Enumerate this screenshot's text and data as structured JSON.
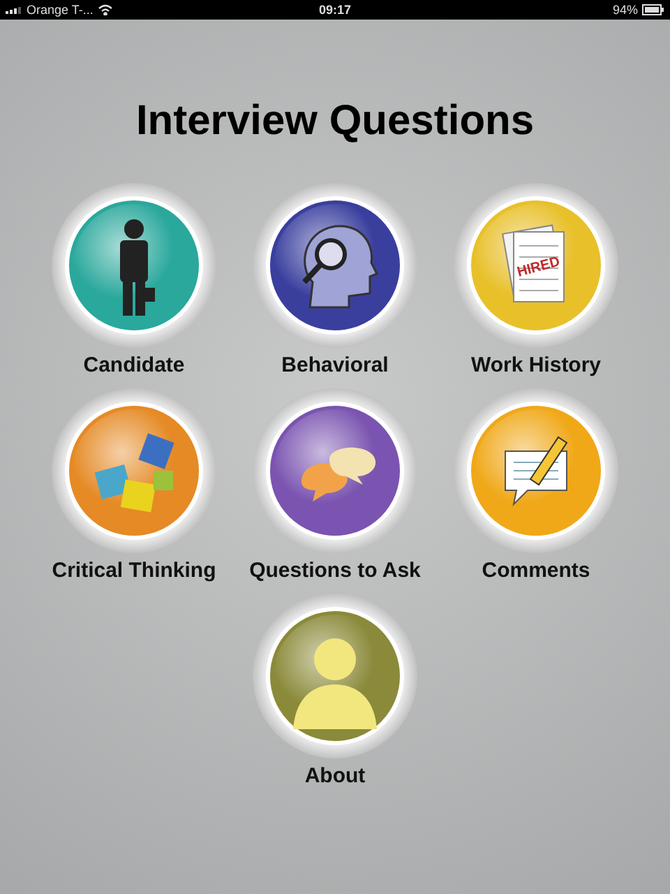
{
  "status_bar": {
    "carrier": "Orange T-...",
    "time": "09:17",
    "battery": "94%"
  },
  "title": "Interview Questions",
  "items": [
    {
      "label": "Candidate",
      "kind": "person",
      "color": "#2aa89c"
    },
    {
      "label": "Behavioral",
      "kind": "head",
      "color": "#3a3f9e"
    },
    {
      "label": "Work History",
      "kind": "document",
      "color": "#e8c02a",
      "stamp": "HIRED"
    },
    {
      "label": "Critical Thinking",
      "kind": "puzzle",
      "color": "#e58a25"
    },
    {
      "label": "Questions to Ask",
      "kind": "speech",
      "color": "#7a54b0"
    },
    {
      "label": "Comments",
      "kind": "comment",
      "color": "#f0a818"
    },
    {
      "label": "About",
      "kind": "silhouette",
      "color": "#8a8a3a"
    }
  ]
}
